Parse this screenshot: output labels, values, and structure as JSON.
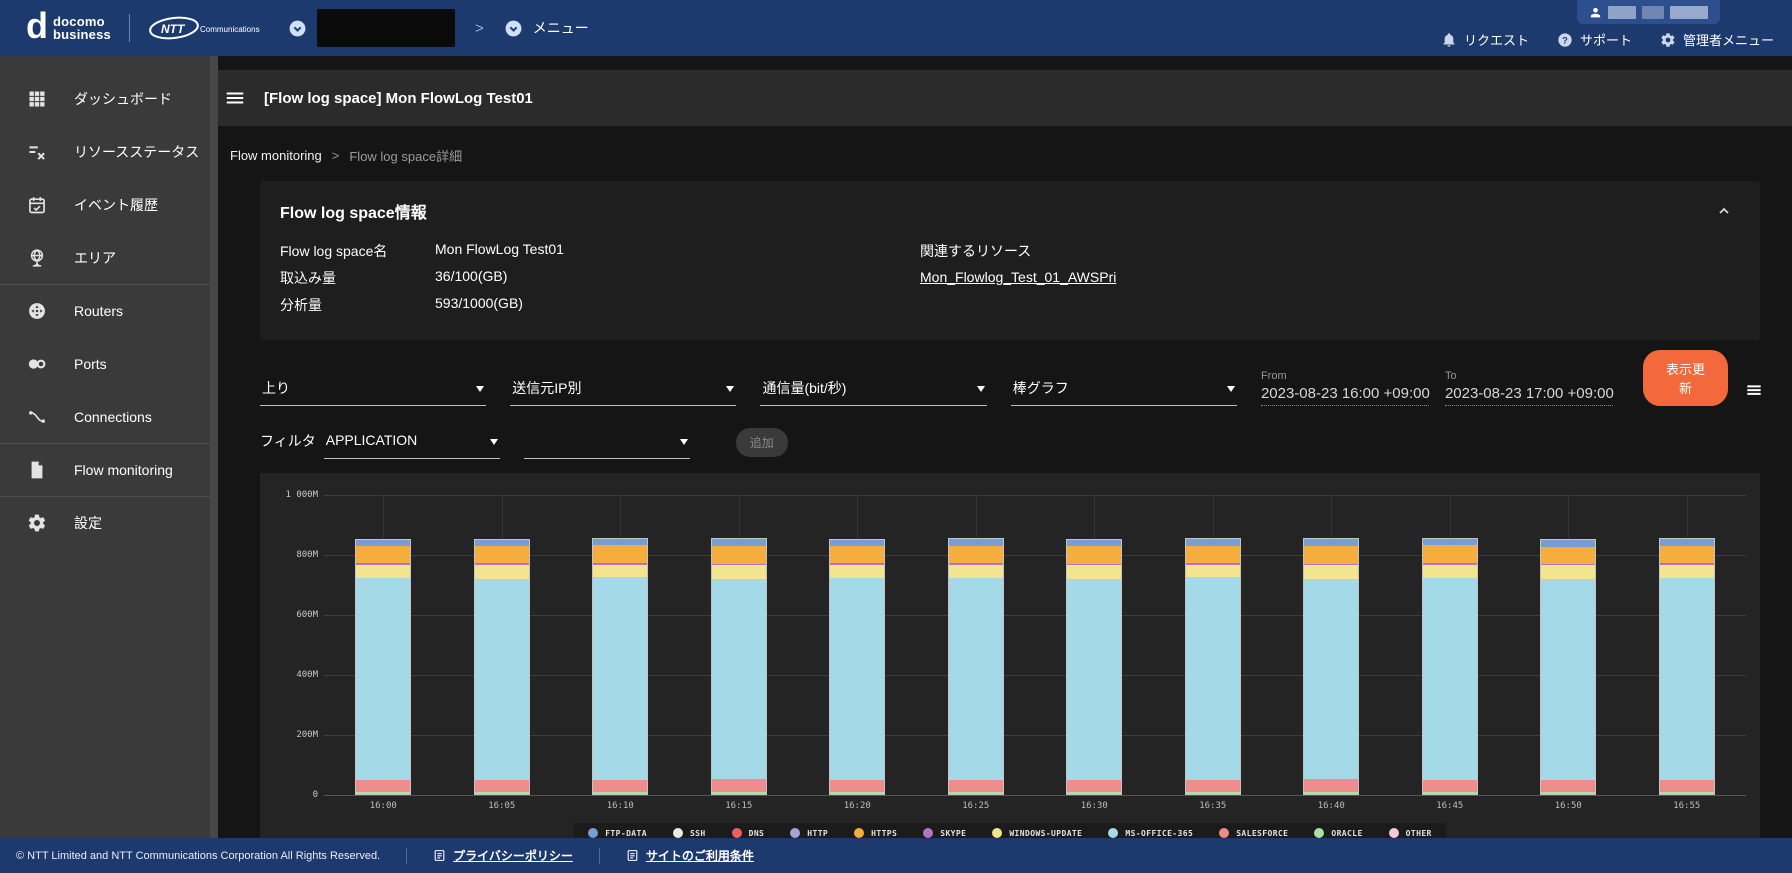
{
  "topnav": {
    "brand": {
      "docomo_line1": "docomo",
      "docomo_line2": "business",
      "ntt": "NTT",
      "ntt_sub": "Communications"
    },
    "menu_label": "メニュー",
    "links": [
      {
        "id": "request",
        "icon": "bell-icon",
        "label": "リクエスト"
      },
      {
        "id": "support",
        "icon": "help-icon",
        "label": "サポート"
      },
      {
        "id": "admin-menu",
        "icon": "gear-icon",
        "label": "管理者メニュー"
      }
    ]
  },
  "sidebar": {
    "items": [
      {
        "id": "dashboard",
        "icon": "grid-icon",
        "label": "ダッシュボード",
        "divider": false
      },
      {
        "id": "resource-status",
        "icon": "resource-status-icon",
        "label": "リソースステータス",
        "divider": false
      },
      {
        "id": "event-history",
        "icon": "event-history-icon",
        "label": "イベント履歴",
        "divider": false
      },
      {
        "id": "area",
        "icon": "area-icon",
        "label": "エリア",
        "divider": false
      },
      {
        "id": "routers",
        "icon": "routers-icon",
        "label": "Routers",
        "divider": true
      },
      {
        "id": "ports",
        "icon": "ports-icon",
        "label": "Ports",
        "divider": false
      },
      {
        "id": "connections",
        "icon": "connections-icon",
        "label": "Connections",
        "divider": false
      },
      {
        "id": "flow-monitoring",
        "icon": "flow-monitoring-icon",
        "label": "Flow monitoring",
        "divider": true
      },
      {
        "id": "settings",
        "icon": "settings-icon",
        "label": "設定",
        "divider": true
      }
    ]
  },
  "page": {
    "title": "[Flow log space] Mon FlowLog Test01"
  },
  "breadcrumb": {
    "parent": "Flow monitoring",
    "separator": ">",
    "current": "Flow log space詳細"
  },
  "info_panel": {
    "title": "Flow log space情報",
    "fields": [
      {
        "label": "Flow log space名",
        "value": "Mon FlowLog Test01"
      },
      {
        "label": "取込み量",
        "value": "36/100(GB)"
      },
      {
        "label": "分析量",
        "value": "593/1000(GB)"
      }
    ],
    "related": {
      "label": "関連するリソース",
      "link": "Mon_Flowlog_Test_01_AWSPri"
    }
  },
  "controls": {
    "selects": [
      {
        "id": "direction-select",
        "value": "上り"
      },
      {
        "id": "groupby-select",
        "value": "送信元IP別"
      },
      {
        "id": "metric-select",
        "value": "通信量(bit/秒)"
      },
      {
        "id": "chart-type-select",
        "value": "棒グラフ"
      }
    ],
    "from": {
      "label": "From",
      "value": "2023-08-23 16:00 +09:00"
    },
    "to": {
      "label": "To",
      "value": "2023-08-23 17:00 +09:00"
    },
    "refresh_label": "表示更新",
    "filter": {
      "label": "フィルタ",
      "type_value": "APPLICATION",
      "value_placeholder": "",
      "add_label": "追加"
    }
  },
  "chart_data": {
    "type": "bar",
    "stacked": true,
    "title": "",
    "xlabel": "",
    "ylabel": "",
    "y_unit": "Mbit/s",
    "ylim": [
      0,
      1000
    ],
    "grid": true,
    "legend_position": "bottom",
    "y_ticks": [
      "1 000M",
      "800M",
      "600M",
      "400M",
      "200M",
      "0"
    ],
    "y_tick_values": [
      1000,
      800,
      600,
      400,
      200,
      0
    ],
    "categories": [
      "16:00",
      "16:05",
      "16:10",
      "16:15",
      "16:20",
      "16:25",
      "16:30",
      "16:35",
      "16:40",
      "16:45",
      "16:50",
      "16:55"
    ],
    "series": [
      {
        "name": "ftp-data",
        "color": "#769dd4",
        "values": [
          22,
          23,
          22,
          24,
          22,
          23,
          22,
          23,
          24,
          22,
          23,
          22
        ]
      },
      {
        "name": "ssh",
        "color": "#ebebe1",
        "values": [
          0,
          0,
          0,
          0,
          0,
          0,
          0,
          0,
          0,
          0,
          0,
          0
        ]
      },
      {
        "name": "dns",
        "color": "#e9605f",
        "values": [
          0,
          0,
          0,
          0,
          0,
          0,
          0,
          0,
          0,
          0,
          0,
          0
        ]
      },
      {
        "name": "http",
        "color": "#a5a5dc",
        "values": [
          0,
          0,
          0,
          0,
          0,
          0,
          0,
          0,
          0,
          0,
          0,
          0
        ]
      },
      {
        "name": "https",
        "color": "#f5ae3d",
        "values": [
          58,
          57,
          59,
          58,
          57,
          58,
          59,
          57,
          58,
          59,
          57,
          58
        ]
      },
      {
        "name": "skype",
        "color": "#b273c4",
        "values": [
          6,
          6,
          6,
          6,
          6,
          6,
          6,
          6,
          6,
          6,
          6,
          6
        ]
      },
      {
        "name": "windows-update",
        "color": "#f2e58e",
        "values": [
          44,
          45,
          43,
          45,
          44,
          44,
          45,
          43,
          44,
          45,
          44,
          44
        ]
      },
      {
        "name": "ms-office-365",
        "color": "#a4dae8",
        "values": [
          678,
          676,
          681,
          674,
          679,
          677,
          676,
          680,
          675,
          678,
          676,
          679
        ]
      },
      {
        "name": "salesforce",
        "color": "#ef8d8d",
        "values": [
          40,
          41,
          40,
          42,
          40,
          41,
          40,
          41,
          42,
          40,
          41,
          40
        ]
      },
      {
        "name": "oracle",
        "color": "#abdfa5",
        "values": [
          7,
          7,
          7,
          7,
          7,
          7,
          7,
          7,
          7,
          7,
          7,
          7
        ]
      },
      {
        "name": "other",
        "color": "#f3c7dc",
        "values": [
          0,
          0,
          0,
          0,
          0,
          0,
          0,
          0,
          0,
          0,
          0,
          0
        ]
      }
    ]
  },
  "footer": {
    "copyright": "© NTT Limited and NTT Communications Corporation All Rights Reserved.",
    "links": [
      {
        "id": "privacy",
        "label": "プライバシーポリシー"
      },
      {
        "id": "terms",
        "label": "サイトのご利用条件"
      }
    ]
  },
  "colors": {
    "accent_orange": "#f4693b",
    "nav_navy": "#1c3a6e"
  }
}
